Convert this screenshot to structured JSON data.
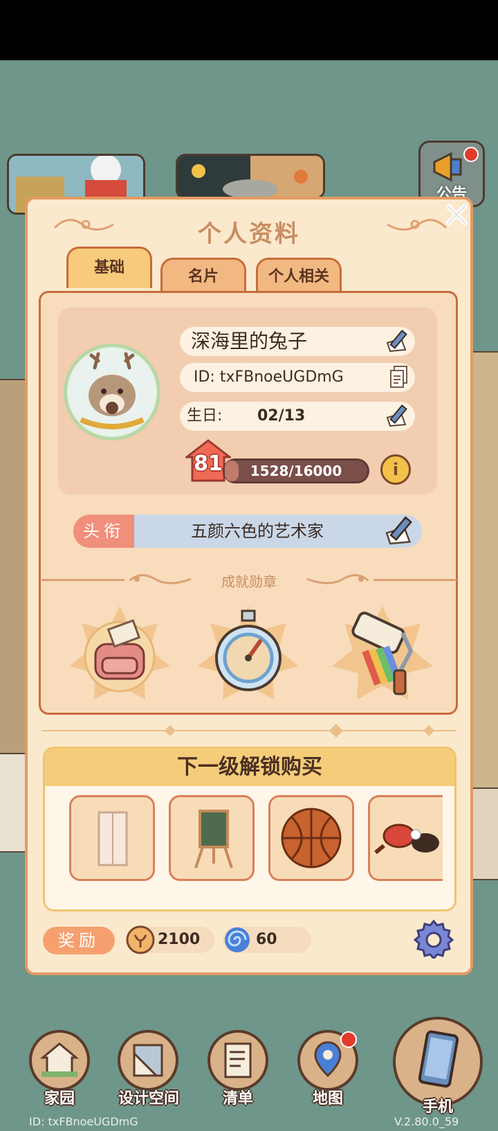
{
  "panel": {
    "title": "个人资料",
    "tabs": [
      {
        "label": "基础",
        "active": true
      },
      {
        "label": "名片",
        "active": false
      },
      {
        "label": "个人相关",
        "active": false
      }
    ]
  },
  "notice": {
    "label": "公告"
  },
  "profile": {
    "nickname": "深海里的兔子",
    "id_text": "ID: txFBnoeUGDmG",
    "birthday_label": "生日:",
    "birthday_value": "02/13",
    "level": "81",
    "xp_text": "1528/16000",
    "xp_progress": 0.0955
  },
  "title_row": {
    "label": "头衔",
    "value": "五颜六色的艺术家"
  },
  "achievements": {
    "label": "成就勋章",
    "badges": [
      "armchair-badge",
      "stopwatch-badge",
      "paint-roller-badge"
    ]
  },
  "unlock": {
    "heading": "下一级解锁购买",
    "items": [
      "wardrobe-item",
      "easel-board-item",
      "basketball-item",
      "ping-pong-item"
    ]
  },
  "rewards": {
    "label": "奖励",
    "coins": "2100",
    "gems": "60"
  },
  "nav": {
    "items": [
      {
        "label": "家园"
      },
      {
        "label": "设计空间"
      },
      {
        "label": "清单"
      },
      {
        "label": "地图"
      },
      {
        "label": "手机"
      }
    ]
  },
  "footer": {
    "id_text": "ID: txFBnoeUGDmG",
    "version": "V.2.80.0_59"
  },
  "colors": {
    "panel_bg": "#fbe9cd",
    "panel_border": "#e49a62",
    "accent_title": "#c98d62"
  }
}
